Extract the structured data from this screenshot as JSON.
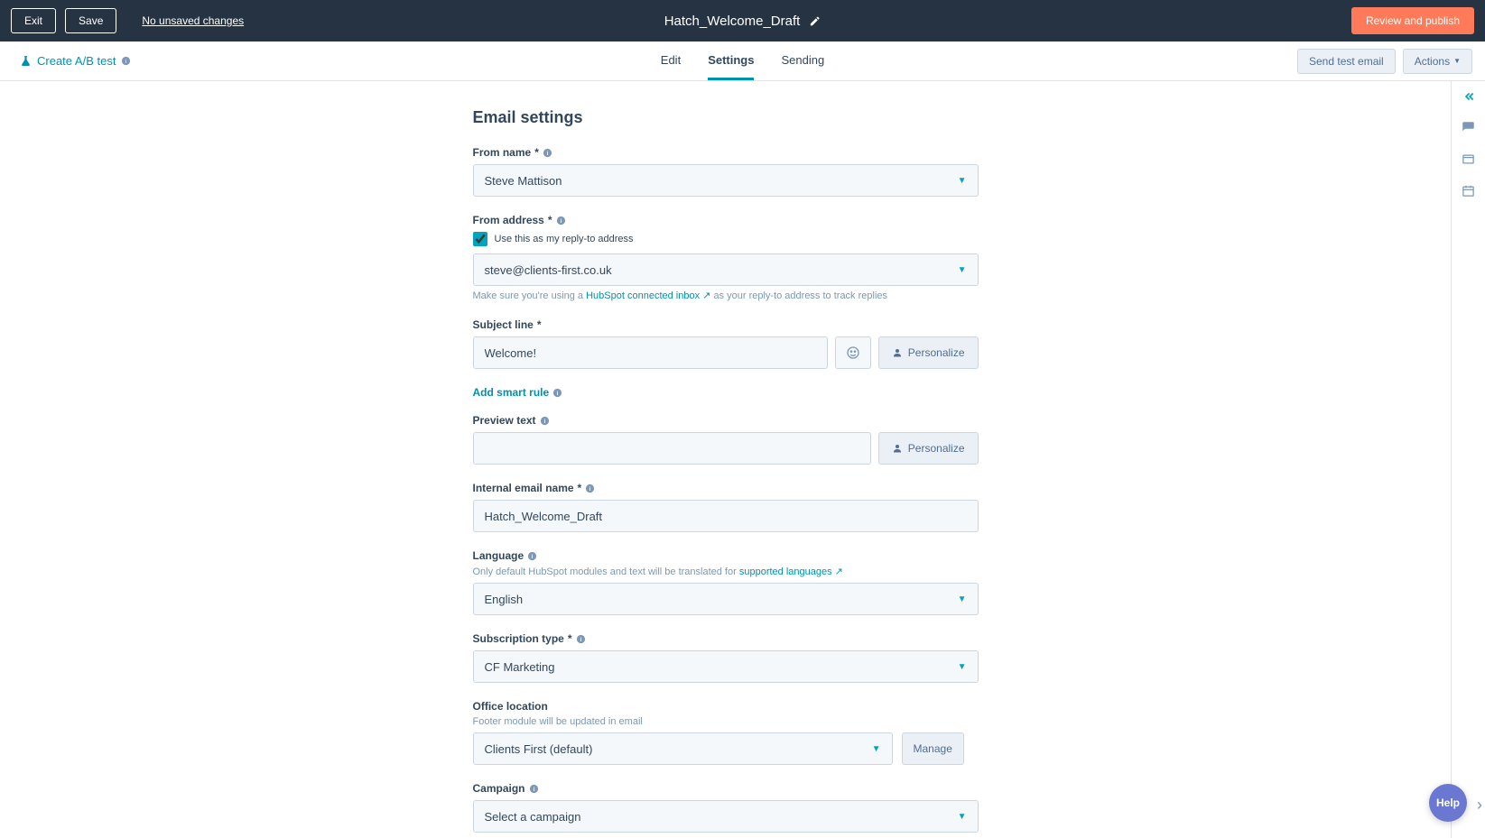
{
  "header": {
    "exit": "Exit",
    "save": "Save",
    "unsaved": "No unsaved changes",
    "title": "Hatch_Welcome_Draft",
    "review": "Review and publish"
  },
  "secondary": {
    "ab": "Create A/B test",
    "tabs": {
      "edit": "Edit",
      "settings": "Settings",
      "sending": "Sending"
    },
    "send_test": "Send test email",
    "actions": "Actions"
  },
  "page": {
    "title": "Email settings",
    "from_name_label": "From name",
    "from_name_value": "Steve Mattison",
    "from_address_label": "From address",
    "reply_to_checkbox": "Use this as my reply-to address",
    "from_address_value": "steve@clients-first.co.uk",
    "from_help_pre": "Make sure you're using a ",
    "from_help_link": "HubSpot connected inbox",
    "from_help_post": " as your reply-to address to track replies",
    "subject_label": "Subject line",
    "subject_value": "Welcome!",
    "personalize": "Personalize",
    "smart_rule": "Add smart rule",
    "preview_label": "Preview text",
    "preview_value": "",
    "internal_label": "Internal email name",
    "internal_value": "Hatch_Welcome_Draft",
    "language_label": "Language",
    "language_help_pre": "Only default HubSpot modules and text will be translated for ",
    "language_help_link": "supported languages",
    "language_value": "English",
    "sub_type_label": "Subscription type",
    "sub_type_value": "CF Marketing",
    "office_label": "Office location",
    "office_help": "Footer module will be updated in email",
    "office_value": "Clients First (default)",
    "manage": "Manage",
    "campaign_label": "Campaign",
    "campaign_value": "Select a campaign"
  },
  "help": "Help"
}
